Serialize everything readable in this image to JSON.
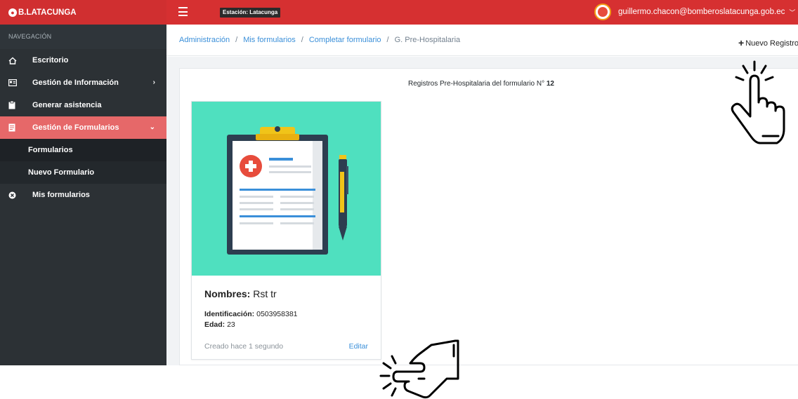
{
  "topbar": {
    "brand": "B.LATACUNGA",
    "station": "Estación: Latacunga",
    "user_email": "guillermo.chacon@bomberoslatacunga.gob.ec",
    "colors": {
      "topbar": "#d63031",
      "sidebar": "#2c3135",
      "active": "#e66869",
      "link": "#3a8fd9",
      "card_image": "#4fe0bf"
    }
  },
  "sidebar": {
    "header": "NAVEGACIÓN",
    "items": [
      {
        "label": "Escritorio",
        "icon": "home-icon"
      },
      {
        "label": "Gestión de Información",
        "icon": "id-card-icon"
      },
      {
        "label": "Generar asistencia",
        "icon": "clipboard-icon"
      },
      {
        "label": "Gestión de Formularios",
        "icon": "form-icon"
      },
      {
        "label": "Formularios"
      },
      {
        "label": "Nuevo Formulario"
      },
      {
        "label": "Mis formularios",
        "icon": "circle-x-icon"
      }
    ]
  },
  "breadcrumb": {
    "items": [
      "Administración",
      "Mis formularios",
      "Completar formulario",
      "G. Pre-Hospitalaria"
    ],
    "separator": "/"
  },
  "actions": {
    "new_record": "Nuevo Registro"
  },
  "panel": {
    "title_prefix": "Registros Pre-Hospitalaria del formulario N°",
    "form_number": "12"
  },
  "card": {
    "name_label": "Nombres:",
    "name_value": "Rst tr",
    "id_label": "Identificación:",
    "id_value": "0503958381",
    "age_label": "Edad:",
    "age_value": "23",
    "created": "Creado hace 1 segundo",
    "edit": "Editar",
    "image_icon": "medical-clipboard-pen-icon"
  },
  "overlays": [
    "pointing-hand-click-icon",
    "pointing-hand-click-icon"
  ]
}
